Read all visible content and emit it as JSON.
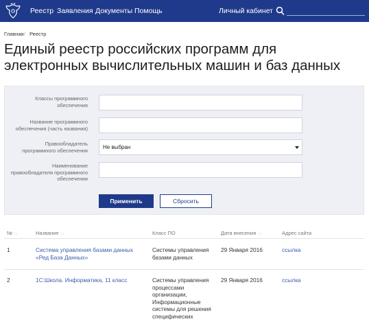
{
  "header": {
    "nav": [
      "Реестр",
      "Заявления",
      "Документы",
      "Помощь"
    ],
    "cabinet": "Личный кабинет",
    "search_placeholder": ""
  },
  "breadcrumb": [
    "Главная",
    "/",
    "Реестр"
  ],
  "title_line1": "Единый реестр российских программ для",
  "title_line2": "электронных вычислительных машин и баз данных",
  "filters": {
    "class_label": [
      "Классы программного",
      "обеспечения"
    ],
    "name_label": [
      "Название программного",
      "обеспечения (часть названия)"
    ],
    "owner_label": [
      "Правообладатель",
      "программного обеспечения"
    ],
    "owner_value": "Не выбран",
    "owner_name_label": [
      "Наименование",
      "правообладателя программного",
      "обеспечения"
    ],
    "apply": "Применить",
    "reset": "Сбросить"
  },
  "table": {
    "headers": [
      "№",
      "Название",
      "Класс ПО",
      "Дата внесения",
      "Адрес сайта"
    ],
    "sort_glyph": "↑↓",
    "rows": [
      {
        "num": "1",
        "name": [
          "Система управления базами данных",
          "«Ред База Данных»"
        ],
        "class": [
          "Системы управления",
          "базами данных"
        ],
        "date": "29 Января 2016",
        "site": "ссылка"
      },
      {
        "num": "2",
        "name": [
          "1С:Школа. Информатика, 11 класс"
        ],
        "class": [
          "Системы управления",
          "процессами",
          "организации,",
          "Информационные",
          "системы для решения",
          "специфических"
        ],
        "date": "29 Января 2016",
        "site": "ссылка"
      }
    ]
  },
  "colors": {
    "brand": "#1f3a8a",
    "link": "#3b5bb0",
    "panel": "#eef0f5"
  }
}
